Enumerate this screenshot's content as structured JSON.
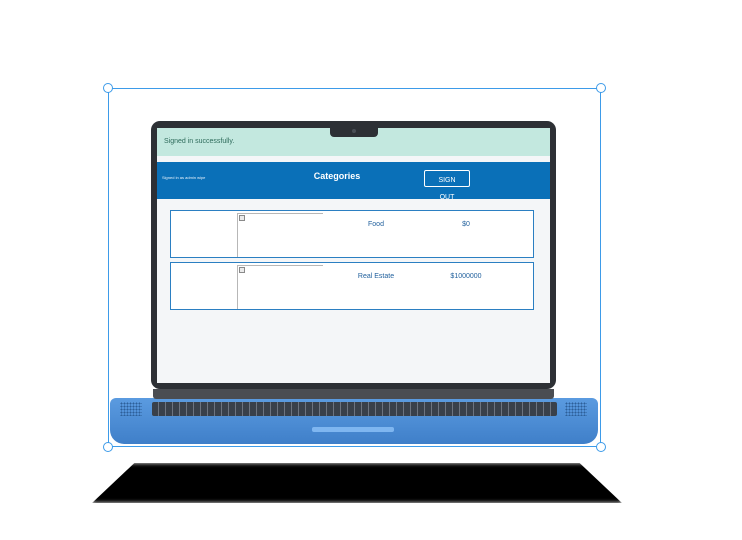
{
  "flash": {
    "message": "Signed in successfully."
  },
  "navbar": {
    "signed_in_as": "Signed in as admin wipe",
    "title": "Categories",
    "sign_out_label": "SIGN OUT"
  },
  "categories": [
    {
      "name": "Food",
      "price": "$0"
    },
    {
      "name": "Real Estate",
      "price": "$1000000"
    }
  ],
  "colors": {
    "navbar": "#0a70b8",
    "flash_bg": "#c3e8df",
    "laptop_base": "#4a8ad6",
    "selection": "#3d9be9"
  }
}
